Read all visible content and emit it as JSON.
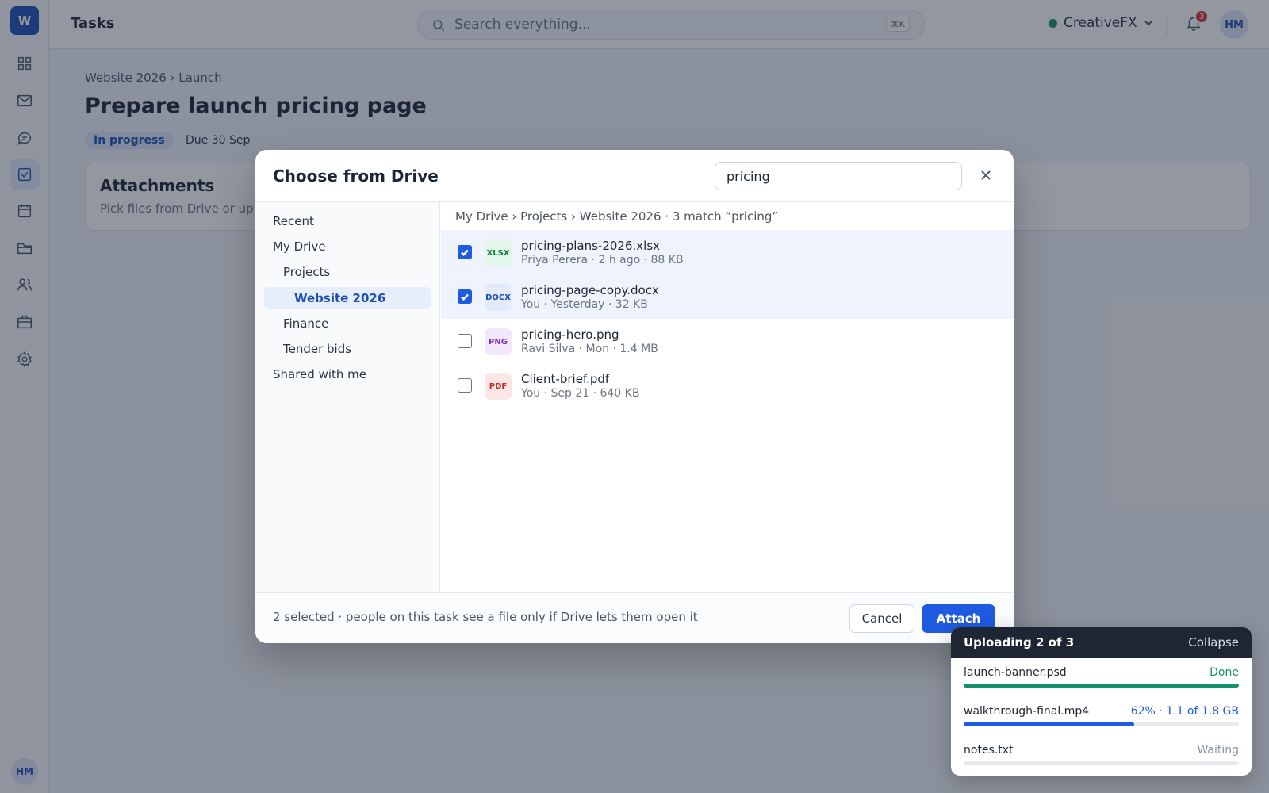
{
  "app": {
    "logo_letter": "W",
    "page_title": "Tasks",
    "user_initials": "HM"
  },
  "rail": {
    "icons": [
      "dashboard-icon",
      "mail-icon",
      "chat-icon",
      "tasks-icon",
      "calendar-icon",
      "folder-icon",
      "people-icon",
      "briefcase-icon",
      "settings-icon"
    ],
    "active": "tasks-icon"
  },
  "search": {
    "placeholder": "Search everything...",
    "shortcut": "⌘K"
  },
  "workspace": {
    "name": "CreativeFX",
    "status_color": "#12916c"
  },
  "notifications": {
    "count": "3"
  },
  "task": {
    "breadcrumb": "Website 2026 › Launch",
    "title": "Prepare launch pricing page",
    "status": "In progress",
    "due": "Due 30 Sep",
    "attachments_title": "Attachments",
    "attachments_hint": "Pick files from Drive or uplo"
  },
  "modal": {
    "title": "Choose from Drive",
    "search_value": "pricing",
    "nav": [
      {
        "label": "Recent",
        "level": 0,
        "selected": false
      },
      {
        "label": "My Drive",
        "level": 0,
        "selected": false
      },
      {
        "label": "Projects",
        "level": 1,
        "selected": false
      },
      {
        "label": "Website 2026",
        "level": 2,
        "selected": true
      },
      {
        "label": "Finance",
        "level": 1,
        "selected": false
      },
      {
        "label": "Tender bids",
        "level": 1,
        "selected": false
      },
      {
        "label": "Shared with me",
        "level": 0,
        "selected": false
      }
    ],
    "location": "My Drive › Projects › Website 2026 · 3 match “pricing”",
    "files": [
      {
        "type": "XLSX",
        "name": "pricing-plans-2026.xlsx",
        "meta": "Priya Perera · 2 h ago · 88 KB",
        "checked": true,
        "bg": "#e2f6ea",
        "fg": "#15803d"
      },
      {
        "type": "DOCX",
        "name": "pricing-page-copy.docx",
        "meta": "You · Yesterday · 32 KB",
        "checked": true,
        "bg": "#e3ebfa",
        "fg": "#1f4fb5"
      },
      {
        "type": "PNG",
        "name": "pricing-hero.png",
        "meta": "Ravi Silva · Mon · 1.4 MB",
        "checked": false,
        "bg": "#f1e8fb",
        "fg": "#7b2fbf"
      },
      {
        "type": "PDF",
        "name": "Client-brief.pdf",
        "meta": "You · Sep 21 · 640 KB",
        "checked": false,
        "bg": "#fde6e6",
        "fg": "#c62828"
      }
    ],
    "footer_note": "2 selected · people on this task see a file only if Drive lets them open it",
    "cancel_label": "Cancel",
    "attach_label": "Attach",
    "accent": "#1f5be0"
  },
  "uploads": {
    "title": "Uploading 2 of 3",
    "collapse_label": "Collapse",
    "items": [
      {
        "name": "launch-banner.psd",
        "status": "Done",
        "progress": 1.0,
        "color": "#12916c"
      },
      {
        "name": "walkthrough-final.mp4",
        "status": "62% · 1.1 of 1.8 GB",
        "progress": 0.62,
        "color": "#1f5be0"
      },
      {
        "name": "notes.txt",
        "status": "Waiting",
        "progress": 0.0,
        "color": "#8a94a3"
      }
    ]
  }
}
